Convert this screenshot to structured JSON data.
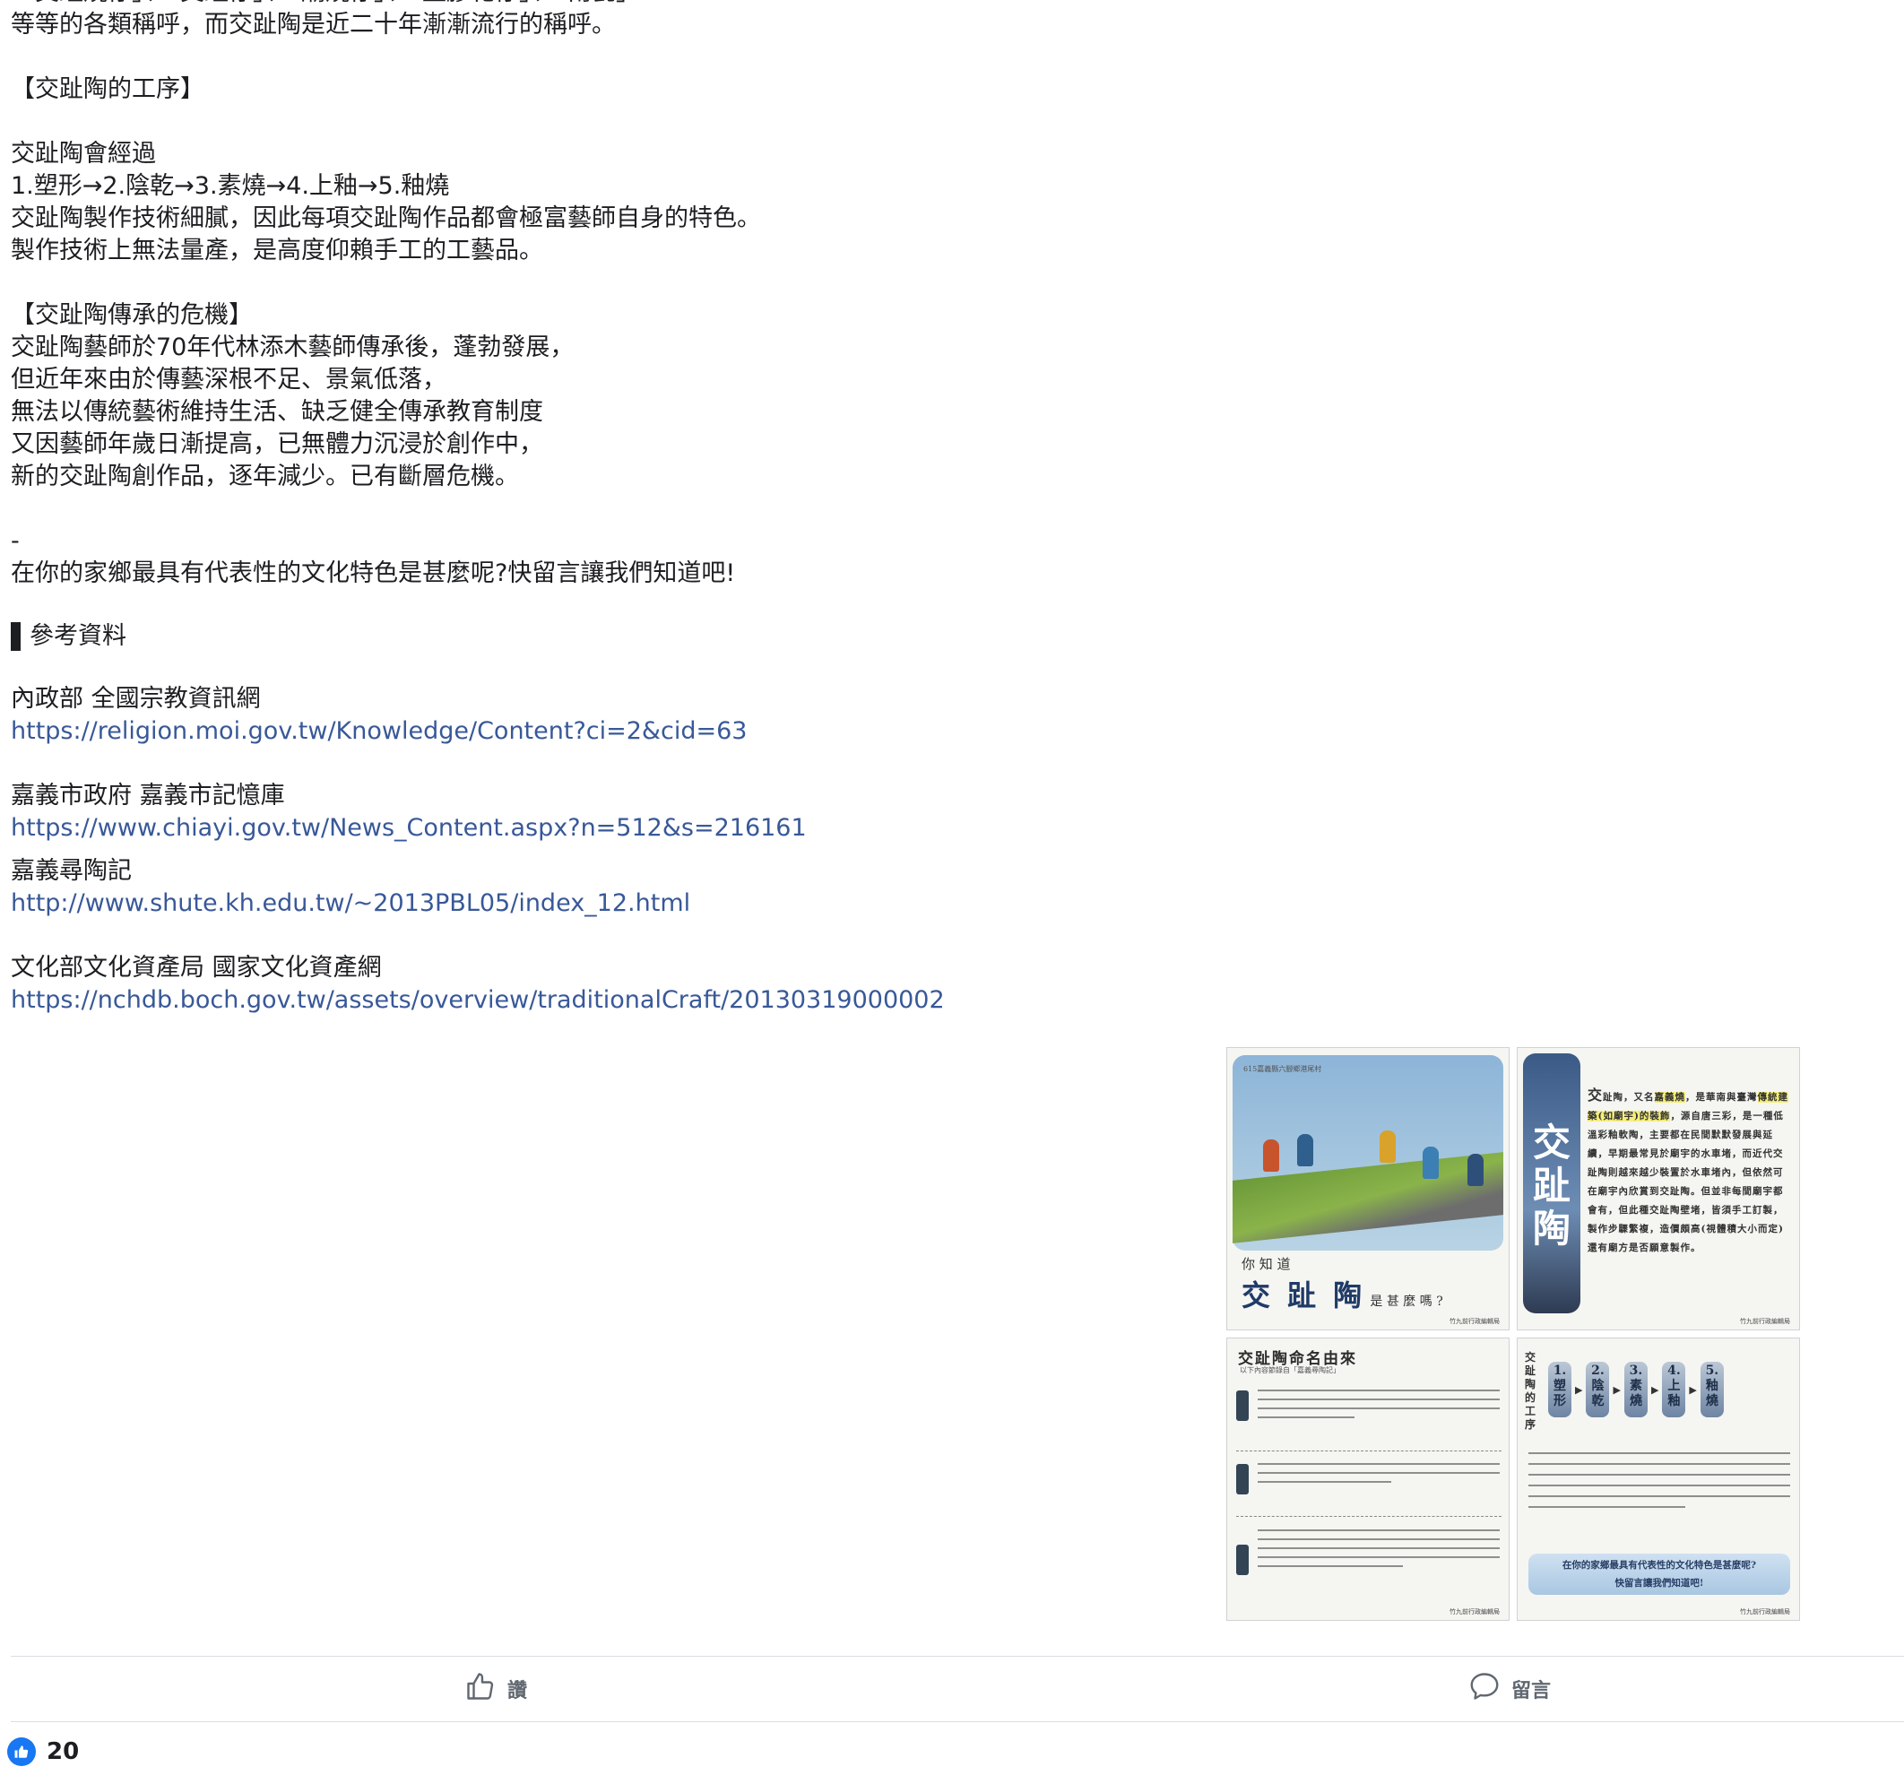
{
  "post": {
    "lines_top": [
      "「交趾燒仔」、「交趾仔」、「廟燒仔」、「塑膠花仔」、「南瓷」",
      "等等的各類稱呼，而交趾陶是近二十年漸漸流行的稱呼。"
    ],
    "section_process_title": "【交趾陶的工序】",
    "process_lines": [
      "交趾陶會經過",
      "1.塑形→2.陰乾→3.素燒→4.上釉→5.釉燒",
      "交趾陶製作技術細膩，因此每項交趾陶作品都會極富藝師自身的特色。",
      "製作技術上無法量產，是高度仰賴手工的工藝品。"
    ],
    "section_crisis_title": "【交趾陶傳承的危機】",
    "crisis_lines": [
      "交趾陶藝師於70年代林添木藝師傳承後，蓬勃發展，",
      "但近年來由於傳藝深根不足、景氣低落，",
      "無法以傳統藝術維持生活、缺乏健全傳承教育制度",
      "又因藝師年歲日漸提高，已無體力沉浸於創作中，",
      "新的交趾陶創作品，逐年減少。已有斷層危機。"
    ],
    "dash": "-",
    "question": "在你的家鄉最具有代表性的文化特色是甚麼呢?快留言讓我們知道吧!",
    "references_title": "參考資料",
    "references": [
      {
        "name": "內政部 全國宗教資訊網",
        "url": "https://religion.moi.gov.tw/Knowledge/Content?ci=2&cid=63"
      },
      {
        "name": "嘉義市政府 嘉義市記憶庫",
        "url": "https://www.chiayi.gov.tw/News_Content.aspx?n=512&s=216161"
      },
      {
        "name": "嘉義尋陶記",
        "url": "http://www.shute.kh.edu.tw/~2013PBL05/index_12.html"
      },
      {
        "name": "文化部文化資產局 國家文化資產網",
        "url": "https://nchdb.boch.gov.tw/assets/overview/traditionalCraft/20130319000002"
      }
    ]
  },
  "images": {
    "tile1": {
      "location": "615嘉義縣六腳鄉港尾村",
      "small": "你 知 道",
      "big": "交 趾 陶",
      "question": "是 甚 麼 嗎 ?",
      "footer": "竹九前行政編輯局"
    },
    "tile2": {
      "vertical_title": "交趾陶",
      "lead": "交",
      "text_a": "趾陶，又名",
      "hl1": "嘉義燒",
      "text_b": "，是華南與臺灣",
      "hl2": "傳統建築(如廟宇)的裝飾",
      "text_c": "，源自唐三彩，是一種低溫彩釉軟陶，主要都在民間默默發展與延續，早期最常見於廟宇的水車堵，而近代交趾陶則越來越少裝置於水車堵內，但依然可在廟宇內欣賞到交趾陶。但並非每間廟宇都會有，但此種交趾陶壁堵，皆須手工訂製，製作步驟繁複，造價頗高(視體積大小而定)還有廟方是否願意製作。",
      "footer": "竹九前行政編輯局"
    },
    "tile3": {
      "title": "交趾陶命名由來",
      "subtitle": "以下內容節錄自「嘉義尋陶記」",
      "footer": "竹九前行政編輯局"
    },
    "tile4": {
      "vertical_label": "交趾陶的工序",
      "steps": [
        "1.塑形",
        "2.陰乾",
        "3.素燒",
        "4.上釉",
        "5.釉燒"
      ],
      "cta_line1": "在你的家鄉最具有代表性的文化特色是甚麼呢?",
      "cta_line2": "快留言讓我們知道吧!",
      "footer": "竹九前行政編輯局"
    }
  },
  "actions": {
    "like_label": "讚",
    "comment_label": "留言"
  },
  "reactions": {
    "count": "20"
  },
  "colors": {
    "link": "#385898",
    "text": "#1c1e21",
    "secondary": "#606770",
    "like_blue": "#1877f2"
  }
}
